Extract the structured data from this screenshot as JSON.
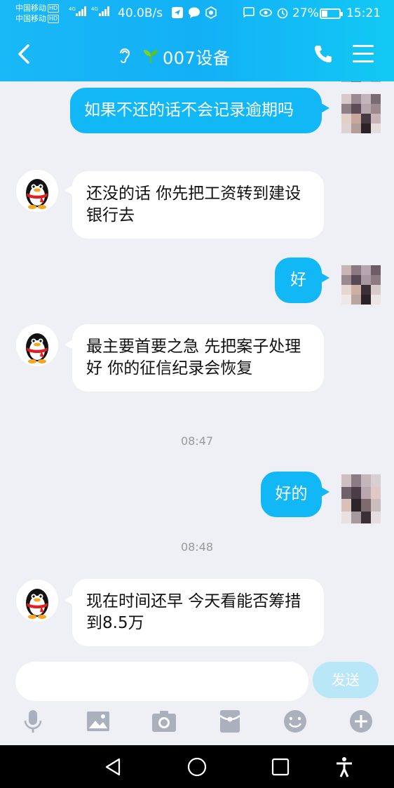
{
  "status_bar": {
    "carrier_1": "中国移动",
    "carrier_2": "中国移动",
    "hd_badge": "HD",
    "network_1": "4G",
    "network_2": "4G",
    "speed": "40.0B/s",
    "battery": "27%",
    "time": "15:21"
  },
  "header": {
    "title": "007设备"
  },
  "messages": [
    {
      "from": "me",
      "text": "如果不还的话不会记录逾期吗"
    },
    {
      "from": "them",
      "text": "还没的话 你先把工资转到建设银行去"
    },
    {
      "from": "me",
      "text": "好"
    },
    {
      "from": "them",
      "text": "最主要首要之急 先把案子处理好 你的征信纪录会恢复"
    },
    {
      "from": "time",
      "text": "08:47"
    },
    {
      "from": "me",
      "text": "好的"
    },
    {
      "from": "time",
      "text": "08:48"
    },
    {
      "from": "them",
      "text": "现在时间还早 今天看能否筹措到8.5万"
    }
  ],
  "input": {
    "placeholder": "",
    "send_label": "发送"
  },
  "colors": {
    "header": "#13b0f6",
    "bubble_me": "#12b7f5",
    "bubble_them": "#ffffff",
    "background": "#eef0f5"
  },
  "toolbar_icons": [
    "microphone-icon",
    "image-icon",
    "camera-icon",
    "red-packet-icon",
    "emoji-icon",
    "plus-icon"
  ]
}
